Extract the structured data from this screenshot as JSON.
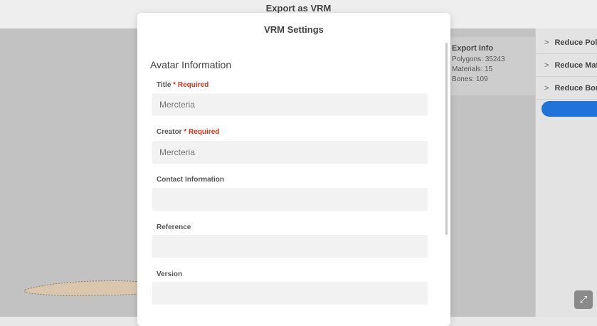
{
  "window": {
    "title": "Export as VRM"
  },
  "export_info": {
    "title": "Export Info",
    "polygons": "Polygons: 35243",
    "materials": "Materials: 15",
    "bones": "Bones: 109"
  },
  "right_panel": {
    "items": [
      {
        "label": "Reduce Polygons"
      },
      {
        "label": "Reduce Materials"
      },
      {
        "label": "Reduce Bones"
      }
    ],
    "accent_color": "#1f73d9"
  },
  "modal": {
    "title": "VRM Settings",
    "section_title": "Avatar Information",
    "required_marker": "* Required",
    "fields": {
      "title": {
        "label": "Title",
        "value": "Mercteria"
      },
      "creator": {
        "label": "Creator",
        "value": "Mercteria"
      },
      "contact": {
        "label": "Contact Information",
        "value": ""
      },
      "reference": {
        "label": "Reference",
        "value": ""
      },
      "version": {
        "label": "Version",
        "value": ""
      }
    }
  },
  "icons": {
    "chevron": "chevron-right-icon",
    "fullscreen": "fullscreen-icon"
  }
}
